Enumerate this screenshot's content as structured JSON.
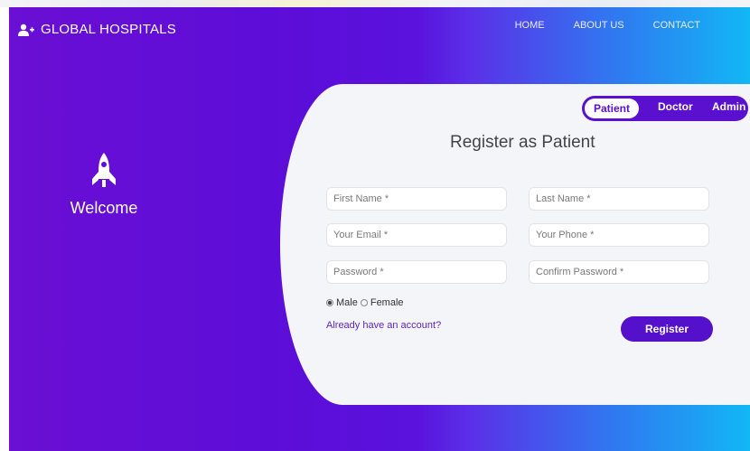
{
  "brand": {
    "name": "GLOBAL HOSPITALS",
    "icon": "user-plus-icon"
  },
  "nav": {
    "items": [
      "HOME",
      "ABOUT US",
      "CONTACT"
    ]
  },
  "left": {
    "icon": "rocket-icon",
    "welcome": "Welcome"
  },
  "toggle": {
    "options": [
      "Patient",
      "Doctor",
      "Admin"
    ],
    "selected": "Patient"
  },
  "form": {
    "title": "Register as Patient",
    "first_name_placeholder": "First Name *",
    "last_name_placeholder": "Last Name *",
    "email_placeholder": "Your Email *",
    "phone_placeholder": "Your Phone *",
    "password_placeholder": "Password *",
    "confirm_password_placeholder": "Confirm Password *",
    "gender": {
      "male": "Male",
      "female": "Female",
      "selected": "Male"
    },
    "login_link": "Already have an account?",
    "register_label": "Register"
  },
  "colors": {
    "primary": "#5510cc",
    "gradient_start": "#6a0fd4",
    "gradient_end": "#12b7f4",
    "card": "#f4f5f9"
  }
}
